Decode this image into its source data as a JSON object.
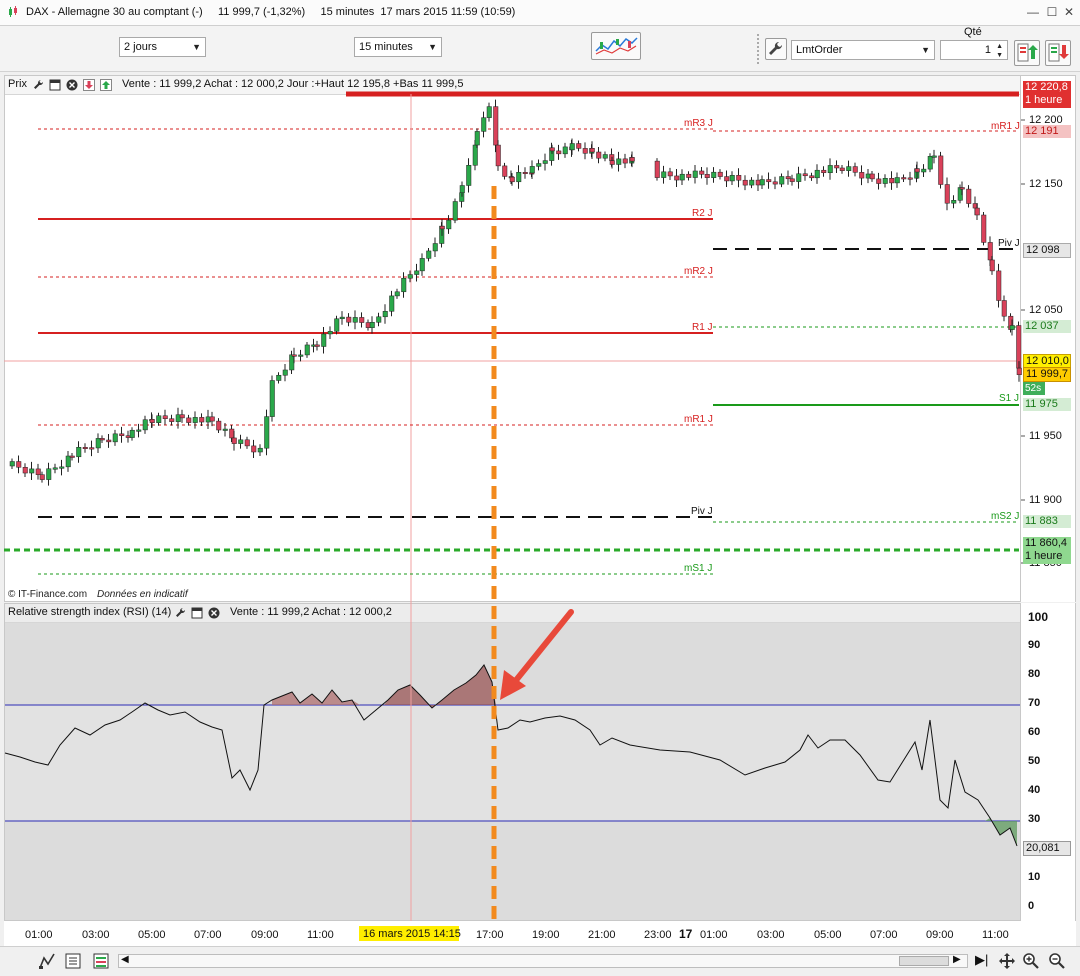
{
  "window": {
    "title": "DAX - Allemagne 30 au comptant (-)     11 999,7 (-1,32%)     15 minutes  17 mars 2015 11:59 (10:59)",
    "minimize": "—",
    "maximize": "☐",
    "close": "✕"
  },
  "toolbar": {
    "period_select": "2 jours",
    "interval_select": "15 minutes",
    "order_type_select": "LmtOrder",
    "qty_label": "Qté",
    "qty_value": "1"
  },
  "price_panel": {
    "title": "Prix",
    "info": "Vente : 11 999,2 Achat : 12 000,2 Jour :+Haut 12 195,8 +Bas 11 999,5",
    "copyright": "© IT-Finance.com",
    "disclaimer": "Données en indicatif",
    "axis_labels": [
      "12 200",
      "12 150",
      "12 050",
      "11 950",
      "11 900",
      "11 850"
    ],
    "tags": {
      "top_price": "12 220,8",
      "top_period": "1 heure",
      "mr1_value": "12 191",
      "pivot_value": "12 098",
      "r1_value": "12 037",
      "crosshair_value": "12 010,0",
      "last_price": "11 999,7",
      "countdown": "52s",
      "s1_value": "11 975",
      "ms2_value": "11 883",
      "bottom_price": "11 860,4",
      "bottom_period": "1 heure"
    },
    "levels": {
      "mR3": "mR3 J",
      "R2": "R2 J",
      "mR2": "mR2 J",
      "R1": "R1 J",
      "mR1": "mR1 J",
      "Piv": "Piv J",
      "mS1": "mS1 J",
      "mR1_right": "mR1 J",
      "Piv_right": "Piv J",
      "S1_right": "S1 J",
      "mS2_right": "mS2 J"
    }
  },
  "rsi_panel": {
    "title": "Relative strength index (RSI) (14)",
    "info": "Vente : 11 999,2 Achat : 12 000,2",
    "axis_labels": [
      "100",
      "90",
      "80",
      "70",
      "60",
      "50",
      "40",
      "30",
      "20",
      "10",
      "0"
    ],
    "last_value": "20,081"
  },
  "time_axis": {
    "labels": [
      "01:00",
      "03:00",
      "05:00",
      "07:00",
      "09:00",
      "11:00",
      "17:00",
      "19:00",
      "21:00",
      "23:00",
      "01:00",
      "03:00",
      "05:00",
      "07:00",
      "09:00",
      "11:00"
    ],
    "day_marker": "17",
    "crosshair_label": "16 mars 2015 14:15"
  },
  "colors": {
    "bull": "#2aa84a",
    "bear": "#d9415a",
    "resistance": "#d62020",
    "support": "#1a9a1a",
    "rsi_band": "#2b2bb5",
    "annotation_orange": "#f28a1e",
    "annotation_arrow": "#e8493a"
  }
}
